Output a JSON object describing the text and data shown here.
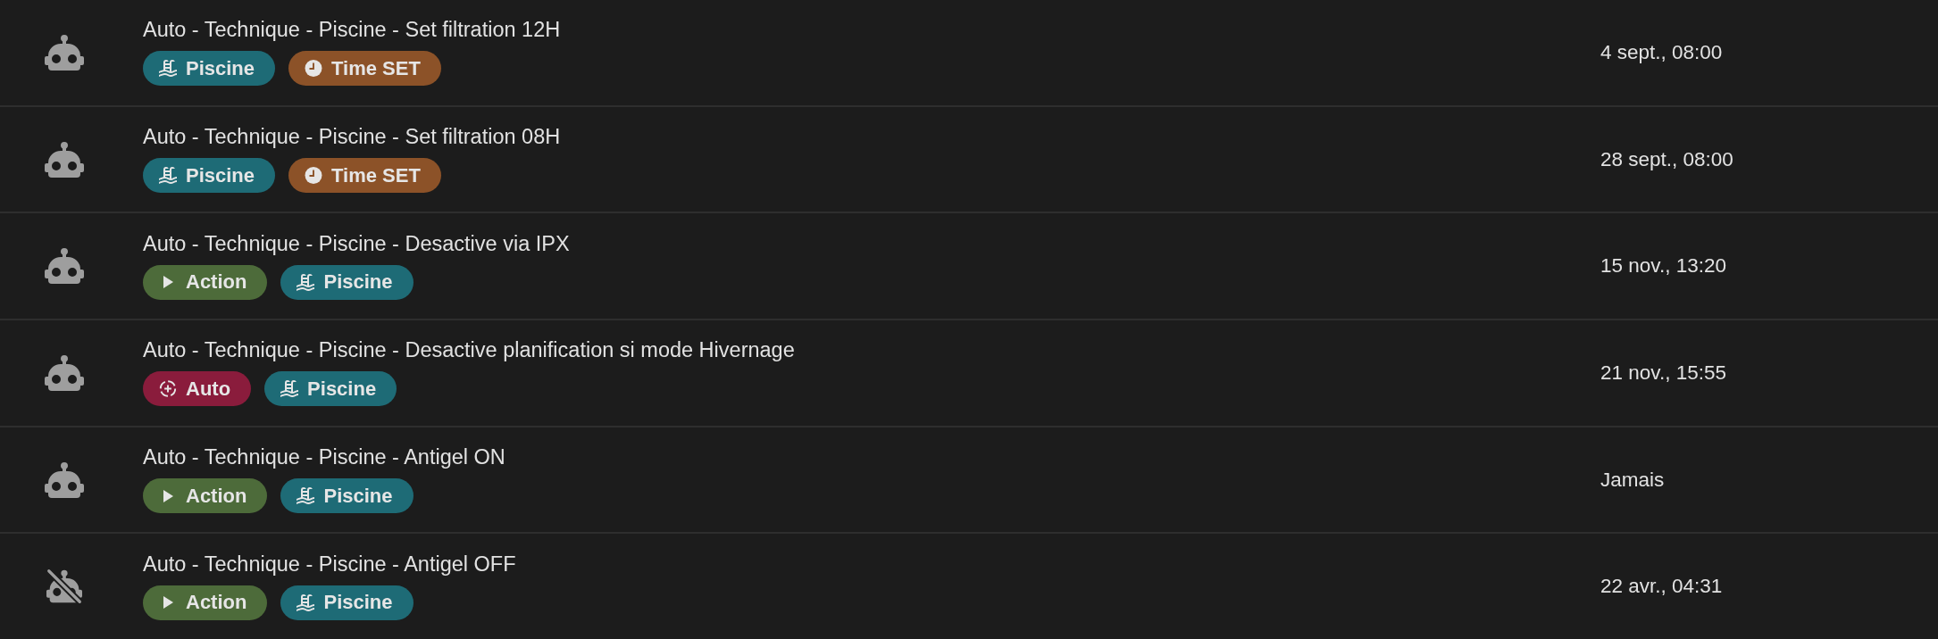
{
  "rows": [
    {
      "enabled": true,
      "title": "Auto - Technique - Piscine - Set filtration 12H",
      "tags": [
        {
          "kind": "area",
          "label": "Piscine",
          "color": "#1e6b76"
        },
        {
          "kind": "schedule",
          "label": "Time SET",
          "color": "#8c5228"
        }
      ],
      "last_triggered": "4 sept., 08:00"
    },
    {
      "enabled": true,
      "title": "Auto - Technique - Piscine - Set filtration 08H",
      "tags": [
        {
          "kind": "area",
          "label": "Piscine",
          "color": "#1e6b76"
        },
        {
          "kind": "schedule",
          "label": "Time SET",
          "color": "#8c5228"
        }
      ],
      "last_triggered": "28 sept., 08:00"
    },
    {
      "enabled": true,
      "title": "Auto - Technique - Piscine - Desactive via IPX",
      "tags": [
        {
          "kind": "action",
          "label": "Action",
          "color": "#4d6b3a"
        },
        {
          "kind": "area",
          "label": "Piscine",
          "color": "#1e6b76"
        }
      ],
      "last_triggered": "15 nov., 13:20"
    },
    {
      "enabled": true,
      "title": "Auto - Technique - Piscine - Desactive planification si mode Hivernage",
      "tags": [
        {
          "kind": "automatic",
          "label": "Auto",
          "color": "#8a1c3c"
        },
        {
          "kind": "area",
          "label": "Piscine",
          "color": "#1e6b76"
        }
      ],
      "last_triggered": "21 nov., 15:55"
    },
    {
      "enabled": true,
      "title": "Auto - Technique - Piscine - Antigel ON",
      "tags": [
        {
          "kind": "action",
          "label": "Action",
          "color": "#4d6b3a"
        },
        {
          "kind": "area",
          "label": "Piscine",
          "color": "#1e6b76"
        }
      ],
      "last_triggered": "Jamais"
    },
    {
      "enabled": false,
      "title": "Auto - Technique - Piscine - Antigel OFF",
      "tags": [
        {
          "kind": "action",
          "label": "Action",
          "color": "#4d6b3a"
        },
        {
          "kind": "area",
          "label": "Piscine",
          "color": "#1e6b76"
        }
      ],
      "last_triggered": "22 avr., 04:31"
    }
  ]
}
